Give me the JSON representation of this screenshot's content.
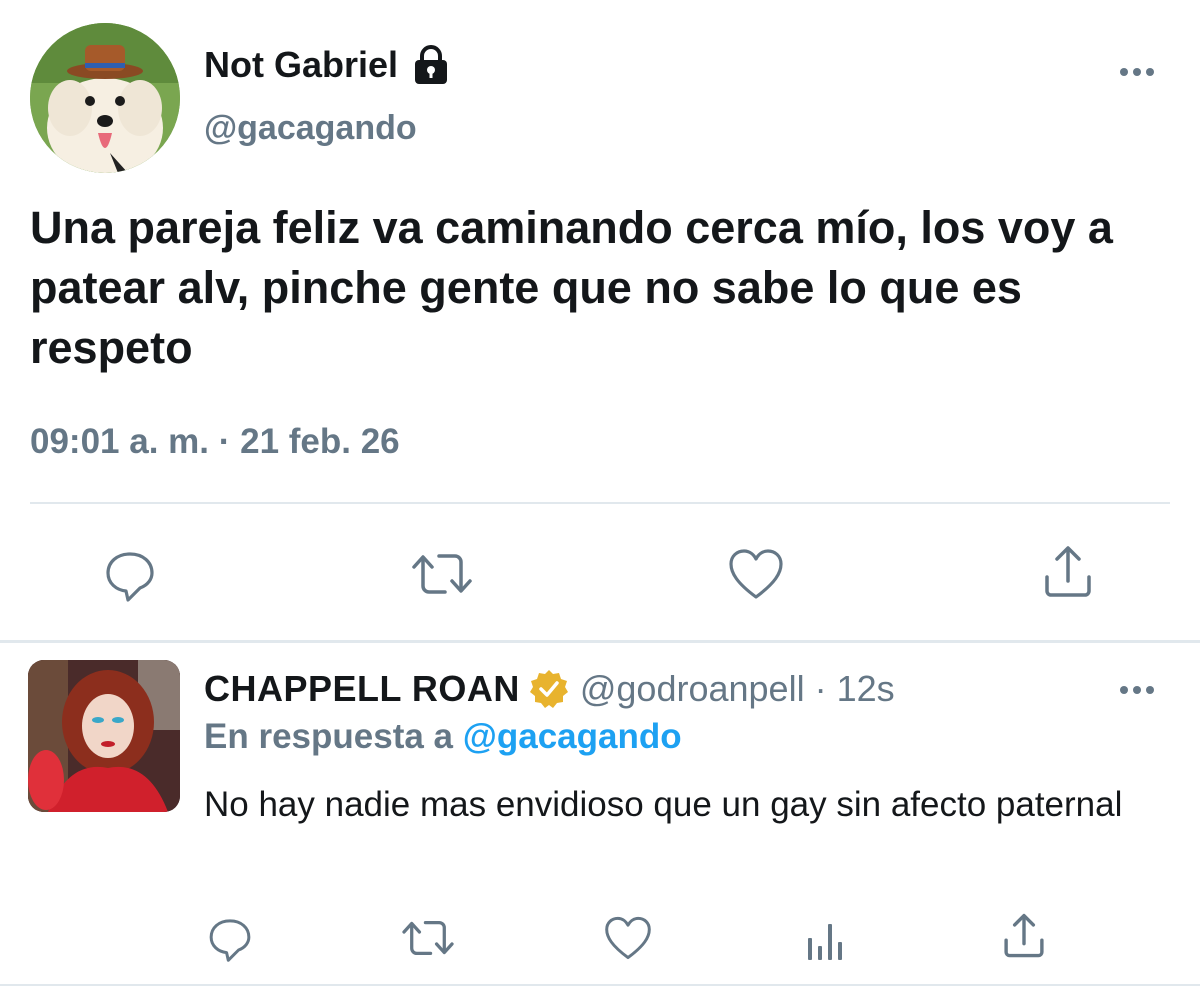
{
  "tweet": {
    "author": {
      "display_name": "Not Gabriel",
      "handle": "@gacagando",
      "avatar_icon": "dog-avatar",
      "badge_icon": "lock-icon"
    },
    "text": "Una pareja feliz va caminando cerca mío, los voy a patear alv, pinche gente que no sabe lo que es respeto",
    "timestamp": "09:01 a. m. · 21 feb. 26",
    "actions": [
      "reply-icon",
      "retweet-icon",
      "like-icon",
      "share-icon"
    ]
  },
  "reply": {
    "author": {
      "display_name": "CHAPPELL ROAN",
      "handle": "@godroanpell",
      "badge_icon": "verified-badge-icon",
      "avatar_icon": "user-photo-avatar"
    },
    "separator": "·",
    "time_ago": "12s",
    "in_reply_to_label": "En respuesta a",
    "in_reply_to_handle": "@gacagando",
    "text": "No hay nadie mas envidioso que un gay sin afecto paternal",
    "actions": [
      "reply-icon",
      "retweet-icon",
      "like-icon",
      "analytics-icon",
      "share-icon"
    ]
  },
  "colors": {
    "text_primary": "#14171a",
    "text_secondary": "#657786",
    "link": "#1da1f2",
    "verified_gold": "#e8b32e",
    "divider": "#e1e8ed"
  }
}
